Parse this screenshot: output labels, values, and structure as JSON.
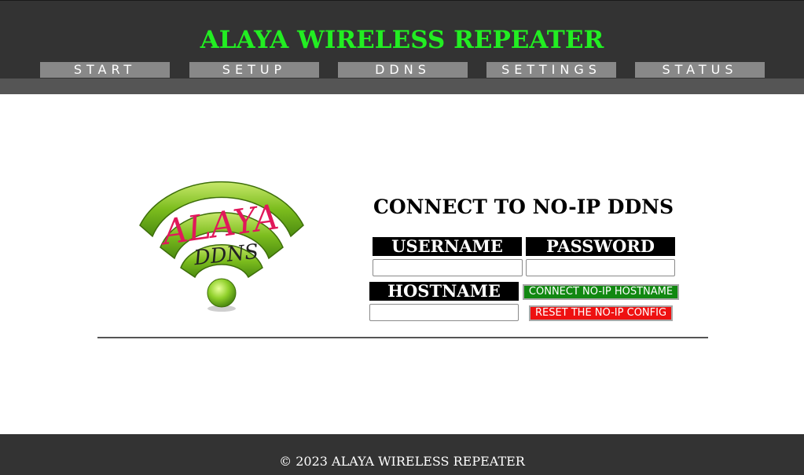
{
  "app": {
    "title": "ALAYA WIRELESS REPEATER"
  },
  "nav": {
    "tabs": [
      {
        "label": "START"
      },
      {
        "label": "SETUP"
      },
      {
        "label": "DDNS"
      },
      {
        "label": "SETTINGS"
      },
      {
        "label": "STATUS"
      }
    ]
  },
  "logo": {
    "brand_text": "ALAYA",
    "sub_text": "DDNS",
    "icon": "wifi-logo-icon"
  },
  "ddns": {
    "title": "CONNECT TO NO-IP DDNS",
    "username_label": "USERNAME",
    "password_label": "PASSWORD",
    "hostname_label": "HOSTNAME",
    "username_value": "",
    "password_value": "",
    "hostname_value": "",
    "connect_button": "CONNECT NO-IP HOSTNAME",
    "reset_button": "RESET THE NO-IP CONFIG"
  },
  "footer": {
    "text": "© 2023 ALAYA WIRELESS REPEATER"
  },
  "colors": {
    "header_bg": "#333333",
    "title_green": "#22ee22",
    "tab_bg": "#888888",
    "subbar_bg": "#555555",
    "connect_green": "#118811",
    "reset_red": "#ee1111"
  }
}
